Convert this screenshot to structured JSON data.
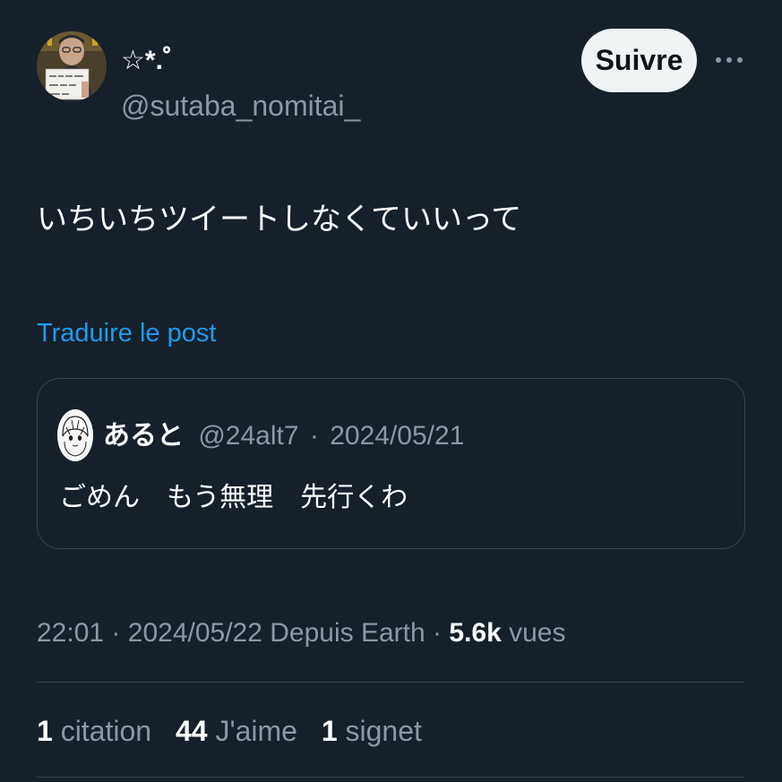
{
  "author": {
    "display_name": "☆*.゜",
    "handle": "@sutaba_nomitai_",
    "avatar_sign_text": "自分がそれ\nされたら\nどう？"
  },
  "follow_button": {
    "label": "Suivre"
  },
  "more_button": {
    "icon": "more-horizontal-icon"
  },
  "tweet": {
    "text": "いちいちツイートしなくていいって",
    "translate_label": "Traduire le post"
  },
  "quoted_post": {
    "name": "あると",
    "handle": "@24alt7",
    "separator": "·",
    "date": "2024/05/21",
    "text": "ごめん　もう無理　先行くわ"
  },
  "meta": {
    "time": "22:01",
    "separator": "·",
    "date": "2024/05/22",
    "source": "Depuis Earth",
    "views_count": "5.6k",
    "views_label": "vues"
  },
  "stats": [
    {
      "count": "1",
      "label": "citation"
    },
    {
      "count": "44",
      "label": "J'aime"
    },
    {
      "count": "1",
      "label": "signet"
    }
  ],
  "colors": {
    "background": "#15202b",
    "text_primary": "#ffffff",
    "text_secondary": "#8b98a5",
    "link": "#1d9bf0",
    "border": "#38444d",
    "button_bg": "#eff3f4"
  }
}
